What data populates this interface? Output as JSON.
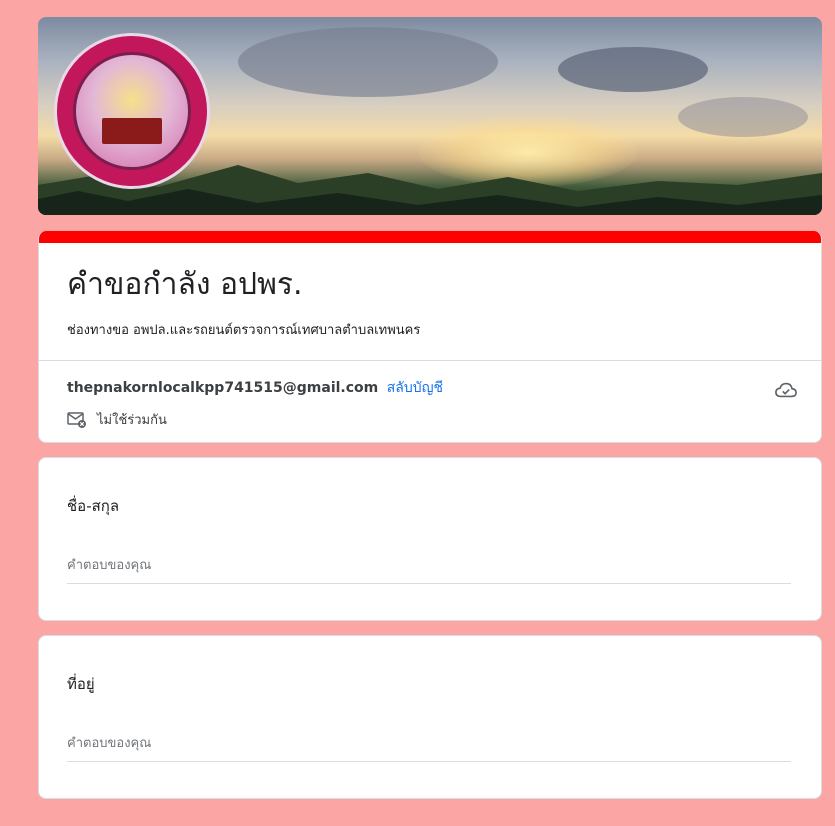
{
  "banner": {
    "logo_alt": "เทศบาลตำบลเทพนคร อ.เมืองกำแพงเพชร จ.กำแพงเพชร"
  },
  "form": {
    "title": "คำขอกำลัง อปพร.",
    "description": "ช่องทางขอ อพปล.และรถยนต์ตรวจการณ์เทศบาลตำบลเทพนคร",
    "accent_color": "#ff0000"
  },
  "account": {
    "email": "thepnakornlocalkpp741515@gmail.com",
    "switch_label": "สลับบัญชี",
    "not_shared_label": "ไม่ใช้ร่วมกัน"
  },
  "questions": [
    {
      "label": "ชื่อ-สกุล",
      "placeholder": "คำตอบของคุณ",
      "value": ""
    },
    {
      "label": "ที่อยู่",
      "placeholder": "คำตอบของคุณ",
      "value": ""
    }
  ],
  "colors": {
    "background": "#fba5a5",
    "link": "#1a73e8"
  }
}
